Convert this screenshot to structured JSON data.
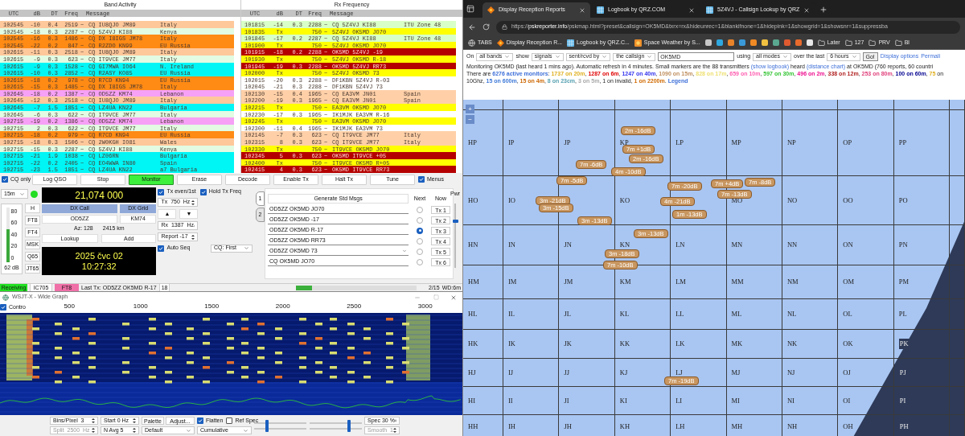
{
  "band_activity": {
    "title": "Band Activity",
    "columns": [
      "UTC",
      "dB",
      "DT",
      "Freq",
      "Message"
    ],
    "rows": [
      {
        "utc": "102545",
        "db": "-10",
        "dt": "0.4",
        "freq": "2519",
        "sep": "~",
        "message": "CQ IU8QJO JM89",
        "note": "Italy",
        "color": "#ffc89b"
      },
      {
        "utc": "102545",
        "db": "-18",
        "dt": "0.3",
        "freq": "2287",
        "sep": "~",
        "message": "CQ 5Z4VJ KI88",
        "note": "Kenya",
        "color": "#e2fbe2"
      },
      {
        "utc": "102545",
        "db": "-16",
        "dt": "0.3",
        "freq": "1486",
        "sep": "~",
        "message": "CQ DX I8IGS JM78",
        "note": "Italy",
        "color": "#ff8a14"
      },
      {
        "utc": "102545",
        "db": "-22",
        "dt": "0.2",
        "freq": "847",
        "sep": "~",
        "message": "CQ R2ZDO KN99",
        "note": "EU Russia",
        "color": "#ff8a14"
      },
      {
        "utc": "102615",
        "db": "-11",
        "dt": "0.3",
        "freq": "2518",
        "sep": "~",
        "message": "CQ IU8QJO JM89",
        "note": "Italy",
        "color": "#ffc89b"
      },
      {
        "utc": "102615",
        "db": "-9",
        "dt": "0.3",
        "freq": "623",
        "sep": "~",
        "message": "CQ IT9VCE JM77",
        "note": "Italy",
        "color": "#e2fbe2"
      },
      {
        "utc": "102615",
        "db": "-9",
        "dt": "0.3",
        "freq": "1528",
        "sep": "~",
        "message": "CQ GI7MWA IO64",
        "note": "N. Ireland",
        "color": "#00f5f5"
      },
      {
        "utc": "102615",
        "db": "-10",
        "dt": "0.3",
        "freq": "2852",
        "sep": "~",
        "message": "CQ R2ASY KO85",
        "note": "EU Russia",
        "color": "#00f5f5"
      },
      {
        "utc": "102615",
        "db": "-18",
        "dt": "0.2",
        "freq": "978",
        "sep": "~",
        "message": "CQ R7CD KN94",
        "note": "EU Russia",
        "color": "#ff8a14"
      },
      {
        "utc": "102615",
        "db": "-15",
        "dt": "0.3",
        "freq": "1485",
        "sep": "~",
        "message": "CQ DX I8IGS JM78",
        "note": "Italy",
        "color": "#ff8a14"
      },
      {
        "utc": "102645",
        "db": "-18",
        "dt": "0.2",
        "freq": "1387",
        "sep": "~",
        "message": "CQ OD5ZZ KM74",
        "note": "Lebanon",
        "color": "#f6a0f6"
      },
      {
        "utc": "102645",
        "db": "-12",
        "dt": "0.3",
        "freq": "2518",
        "sep": "~",
        "message": "CQ IU8QJO JM89",
        "note": "Italy",
        "color": "#ffc89b"
      },
      {
        "utc": "102645",
        "db": "-7",
        "dt": "1.5",
        "freq": "1851",
        "sep": "~",
        "message": "CQ LZ4UA KN22",
        "note": "Bulgaria",
        "color": "#00f5f5"
      },
      {
        "utc": "102645",
        "db": "-6",
        "dt": "0.3",
        "freq": "622",
        "sep": "~",
        "message": "CQ IT9VCE JM77",
        "note": "Italy",
        "color": "#e2fbe2"
      },
      {
        "utc": "102715",
        "db": "-19",
        "dt": "0.2",
        "freq": "1386",
        "sep": "~",
        "message": "CQ OD5ZZ KM74",
        "note": "Lebanon",
        "color": "#f6a0f6"
      },
      {
        "utc": "102715",
        "db": "2",
        "dt": "0.3",
        "freq": "622",
        "sep": "~",
        "message": "CQ IT9VCE JM77",
        "note": "Italy",
        "color": "#e2fbe2"
      },
      {
        "utc": "102715",
        "db": "-18",
        "dt": "0.2",
        "freq": "979",
        "sep": "~",
        "message": "CQ R7CD KN94",
        "note": "EU Russia",
        "color": "#ff8a14"
      },
      {
        "utc": "102715",
        "db": "-18",
        "dt": "0.3",
        "freq": "1506",
        "sep": "~",
        "message": "CQ 2W0KGH IO81",
        "note": "Wales",
        "color": "#ffc89b"
      },
      {
        "utc": "102715",
        "db": "-15",
        "dt": "0.3",
        "freq": "2287",
        "sep": "~",
        "message": "CQ 5Z4VJ KI88",
        "note": "Kenya",
        "color": "#e2fbe2"
      },
      {
        "utc": "102715",
        "db": "-21",
        "dt": "1.9",
        "freq": "1038",
        "sep": "~",
        "message": "CQ LZ06RN",
        "note": "Bulgaria",
        "color": "#00f5f5"
      },
      {
        "utc": "102715",
        "db": "-22",
        "dt": "0.2",
        "freq": "2405",
        "sep": "~",
        "message": "CQ EO4WWA IN80",
        "note": "Spain",
        "color": "#00f5f5"
      },
      {
        "utc": "102715",
        "db": "-23",
        "dt": "1.5",
        "freq": "1851",
        "sep": "~",
        "message": "CQ LZ4UA KN22",
        "note": "a7 Bulgaria",
        "color": "#00f5f5"
      }
    ]
  },
  "rx_frequency": {
    "title": "Rx Frequency",
    "columns": [
      "UTC",
      "dB",
      "DT",
      "Freq",
      "Message"
    ],
    "rows": [
      {
        "utc": "101815",
        "db": "-14",
        "dt": "0.3",
        "freq": "2288",
        "sep": "~",
        "message": "CQ 5Z4VJ KI88",
        "note": "ITU Zone 48",
        "color": "#d8ffc8"
      },
      {
        "utc": "101835",
        "db": "Tx",
        "freq": "750",
        "sep": "~",
        "message": "5Z4VJ OK5MD JO70",
        "color": "#ffff00"
      },
      {
        "utc": "101845",
        "db": "-17",
        "dt": "0.2",
        "freq": "2287",
        "sep": "~",
        "message": "CQ 5Z4VJ KI88",
        "note": "ITU Zone 48",
        "color": "#d8ffc8"
      },
      {
        "utc": "101900",
        "db": "Tx",
        "freq": "750",
        "sep": "~",
        "message": "5Z4VJ OK5MD JO70",
        "color": "#ffff00"
      },
      {
        "utc": "101915",
        "db": "-18",
        "dt": "0.2",
        "freq": "2288",
        "sep": "~",
        "message": "OK5MD 5Z4VJ -19",
        "color": "#b40000"
      },
      {
        "utc": "101930",
        "db": "Tx",
        "freq": "750",
        "sep": "~",
        "message": "5Z4VJ OK5MD R-18",
        "color": "#ffff00"
      },
      {
        "utc": "101945",
        "db": "-19",
        "dt": "0.3",
        "freq": "2288",
        "sep": "~",
        "message": "OK5MD 5Z4VJ RR73",
        "color": "#b40000"
      },
      {
        "utc": "102000",
        "db": "Tx",
        "freq": "750",
        "sep": "~",
        "message": "5Z4VJ OK5MD 73",
        "color": "#ffff00"
      },
      {
        "utc": "102015",
        "db": "-20",
        "dt": "0.3",
        "freq": "2288",
        "sep": "~",
        "message": "DF1KBN 5Z4VJ R-03",
        "color": "#ffffff"
      },
      {
        "utc": "102045",
        "db": "-21",
        "dt": "0.3",
        "freq": "2288",
        "sep": "~",
        "message": "DF1KBN 5Z4VJ 73",
        "color": "#ffffff"
      },
      {
        "utc": "102130",
        "db": "-15",
        "dt": "0.4",
        "freq": "1965",
        "sep": "~",
        "message": "CQ EA3VM JN01",
        "note": "Spain",
        "color": "#ffd0a8"
      },
      {
        "utc": "102200",
        "db": "-19",
        "dt": "0.3",
        "freq": "1965",
        "sep": "~",
        "message": "CQ EA3VM JN01",
        "note": "Spain",
        "color": "#ffd0a8"
      },
      {
        "utc": "102215",
        "db": "Tx",
        "freq": "750",
        "sep": "~",
        "message": "EA3VM OK5MD JO70",
        "color": "#ffff00"
      },
      {
        "utc": "102230",
        "db": "-17",
        "dt": "0.3",
        "freq": "1965",
        "sep": "~",
        "message": "IK1MJK EA3VM R-16",
        "color": "#ffffff"
      },
      {
        "utc": "102245",
        "db": "Tx",
        "freq": "750",
        "sep": "~",
        "message": "EA3VM OK5MD JO70",
        "color": "#ffff00"
      },
      {
        "utc": "102300",
        "db": "-11",
        "dt": "0.4",
        "freq": "1965",
        "sep": "~",
        "message": "IK1MJK EA3VM 73",
        "color": "#ffffff"
      },
      {
        "utc": "102145",
        "db": "-7",
        "dt": "0.3",
        "freq": "623",
        "sep": "~",
        "message": "CQ IT9VCE JM77",
        "note": "Italy",
        "color": "#ffd0a8"
      },
      {
        "utc": "102315",
        "db": "8",
        "dt": "0.3",
        "freq": "623",
        "sep": "~",
        "message": "CQ IT9VCE JM77",
        "note": "Italy",
        "color": "#ffd0a8"
      },
      {
        "utc": "102330",
        "db": "Tx",
        "freq": "750",
        "sep": "~",
        "message": "IT9VCE OK5MD JO70",
        "color": "#ffff00"
      },
      {
        "utc": "102345",
        "db": "5",
        "dt": "0.3",
        "freq": "623",
        "sep": "~",
        "message": "OK5MD IT9VCE +05",
        "color": "#b40000"
      },
      {
        "utc": "102400",
        "db": "Tx",
        "freq": "750",
        "sep": "~",
        "message": "IT9VCE OK5MD R+05",
        "color": "#ffff00"
      },
      {
        "utc": "102415",
        "db": "4",
        "dt": "0.3",
        "freq": "623",
        "sep": "~",
        "message": "OK5MD IT9VCE RR73",
        "color": "#b40000"
      }
    ]
  },
  "controls": {
    "cq_only": {
      "label": "CQ only",
      "checked": true
    },
    "top_buttons": [
      {
        "label": "Log QSO",
        "on": false
      },
      {
        "label": "Stop",
        "on": false
      },
      {
        "label": "Monitor",
        "on": true
      },
      {
        "label": "Erase",
        "on": false
      },
      {
        "label": "Decode",
        "on": false
      },
      {
        "label": "Enable Tx",
        "on": false
      },
      {
        "label": "Halt Tx",
        "on": false
      },
      {
        "label": "Tune",
        "on": false
      }
    ],
    "menus": {
      "label": "Menus",
      "checked": true
    },
    "band": "15m",
    "frequency": "21,074 000",
    "meter": {
      "ticks": [
        "80",
        "60",
        "40",
        "20",
        "0"
      ],
      "level": 0.6,
      "reading": "62 dB"
    },
    "modes": [
      "H",
      "FT8",
      "FT4",
      "MSK",
      "Q65",
      "JT65"
    ],
    "dx": {
      "call_label": "DX Call",
      "grid_label": "DX Grid",
      "call": "OD5ZZ",
      "grid": "KM74",
      "az": "Az: 128",
      "distance": "2415 km"
    },
    "lookup": "Lookup",
    "add": "Add",
    "clock": {
      "date": "2025 čvc 02",
      "time": "10:27:32"
    },
    "tx_even": {
      "label": "Tx even/1st",
      "checked": true
    },
    "hold_tx": {
      "label": "Hold Tx Freq",
      "checked": true
    },
    "tx_freq": "Tx  750  Hz",
    "up": "▲",
    "down": "▼",
    "rx_freq": "Rx  1387  Hz",
    "report": "Report -17",
    "auto_seq": {
      "label": "Auto Seq",
      "checked": true
    },
    "cq_mode": "CQ: First",
    "msg_tabs": [
      {
        "label": "1",
        "selected": true
      },
      {
        "label": "2",
        "selected": false
      }
    ],
    "generate": "Generate Std Msgs",
    "next_label": "Next",
    "now_label": "Now",
    "messages": [
      {
        "text": "OD5ZZ OK5MD JO70",
        "kind": "field",
        "selected": false,
        "button": "Tx 1"
      },
      {
        "text": "OD5ZZ OK5MD -17",
        "kind": "field",
        "selected": false,
        "button": "Tx 2"
      },
      {
        "text": "OD5ZZ OK5MD R-17",
        "kind": "field",
        "selected": true,
        "button": "Tx 3"
      },
      {
        "text": "OD5ZZ OK5MD RR73",
        "kind": "field",
        "selected": false,
        "button": "Tx 4"
      },
      {
        "text": "OD5ZZ OK5MD 73",
        "kind": "dropdown",
        "selected": false,
        "button": "Tx 5"
      },
      {
        "text": "CQ OK5MD JO70",
        "kind": "field",
        "selected": false,
        "button": "Tx 6"
      }
    ],
    "pwr": {
      "label": "Pwr",
      "level": 0.75
    }
  },
  "status_bar": {
    "state": "Receiving",
    "rig": "IC705",
    "mode": "FT8",
    "last_tx": "Last Tx: OD5ZZ OK5MD R-17",
    "count": "18",
    "progress": {
      "level": 0.13
    },
    "period": "2/15",
    "wd": "WD:6m"
  },
  "wide_graph": {
    "title": "WSJT-X - Wide Graph",
    "control": {
      "label": "Contro",
      "checked": true
    },
    "scale": [
      "500",
      "1000",
      "1500",
      "2000",
      "2500",
      "3000"
    ],
    "bins": "Bins/Pixel  3",
    "split": {
      "text": "Split  2500  Hz",
      "disabled": true
    },
    "start": "Start 0 Hz",
    "navg": "N Avg 5",
    "palette_label": "Palette",
    "adjust": "Adjust...",
    "palette": "Default",
    "flatten": {
      "label": "Flatten",
      "checked": true
    },
    "ref_spec": {
      "label": "Ref Spec",
      "checked": false
    },
    "spectrum_mode": "Cumulative",
    "sliders": [
      {
        "level": 0.25
      },
      {
        "level": 0.76
      },
      {
        "level": 0.25
      },
      {
        "level": 0.76
      }
    ],
    "spec": "Spec 30 %",
    "smooth": {
      "text": "Smooth  1",
      "disabled": true
    }
  },
  "browser": {
    "tabs": [
      {
        "title": "Display Reception Reports",
        "kind": "psk",
        "selected": true
      },
      {
        "title": "Logbook by QRZ.COM",
        "kind": "qrz",
        "selected": false
      },
      {
        "title": "5Z4VJ - Callsign Lookup by QRZ",
        "kind": "qrz",
        "selected": false
      }
    ],
    "address": {
      "scheme": "https://",
      "host": "pskreporter.info",
      "path": "/pskmap.html?preset&callsign=OK5MD&txrx=rx&hideunrec=1&blankifnone=1&hidepink=1&showgrid=1&showsnr=1&suppressba"
    },
    "bookmarks": [
      {
        "kind": "globe",
        "label": "TABS"
      },
      {
        "kind": "psk",
        "label": "Display Reception R..."
      },
      {
        "kind": "qrz",
        "label": "Logbook by QRZ.C..."
      },
      {
        "kind": "sun",
        "label": "Space Weather by S..."
      },
      {
        "kind": "icon",
        "color": "#c8c8c8"
      },
      {
        "kind": "icon",
        "color": "#2fa8e0"
      },
      {
        "kind": "icon",
        "color": "#e8832a"
      },
      {
        "kind": "icon",
        "color": "#3a9ad9"
      },
      {
        "kind": "icon",
        "color": "#f08a24"
      },
      {
        "kind": "icon",
        "color": "#f0c040"
      },
      {
        "kind": "icon",
        "color": "#5aa890"
      },
      {
        "kind": "icon",
        "color": "#e05a30"
      },
      {
        "kind": "icon",
        "color": "#e86a2c"
      },
      {
        "kind": "icon",
        "color": "#e8e8e8"
      },
      {
        "kind": "folder",
        "label": "Later"
      },
      {
        "kind": "folder",
        "label": "127"
      },
      {
        "kind": "folder",
        "label": "PRV"
      },
      {
        "kind": "folder",
        "label": "Bl"
      }
    ],
    "form": [
      {
        "kind": "text",
        "text": "On"
      },
      {
        "kind": "select",
        "text": "all bands"
      },
      {
        "kind": "text",
        "text": "show"
      },
      {
        "kind": "select",
        "text": "signals"
      },
      {
        "kind": "select",
        "text": "sent/rcvd by"
      },
      {
        "kind": "select",
        "text": "the callsign"
      },
      {
        "kind": "input",
        "text": "OK5MD"
      },
      {
        "kind": "text",
        "text": "using"
      },
      {
        "kind": "select",
        "text": "all modes"
      },
      {
        "kind": "text",
        "text": "over the last"
      },
      {
        "kind": "select",
        "text": "6 hours"
      },
      {
        "kind": "button",
        "text": "Go!"
      },
      {
        "kind": "link",
        "text": "Display options"
      },
      {
        "kind": "link",
        "text": "Permali"
      }
    ],
    "monitoring": [
      {
        "text": "Monitoring OK5MD (last heard 1 mins ago). Automatic refresh in 4 minutes. Small markers are the 88 transmitters "
      },
      {
        "text": "(show logbook)",
        "link": true
      },
      {
        "text": " heard "
      },
      {
        "text": "(distance chart)",
        "link": true
      },
      {
        "text": " at OK5MD (760 reports, 60 countri"
      }
    ],
    "monitors": [
      {
        "text": "There are "
      },
      {
        "text": "6276 active monitors",
        "color": "#3d6fd8"
      },
      {
        "text": ": "
      },
      {
        "text": "1737 on 20m",
        "color": "#e0b020",
        "sep": ", "
      },
      {
        "text": "1287 on 6m",
        "color": "#e00000",
        "sep": ", "
      },
      {
        "text": "1247 on 40m",
        "color": "#3333ee",
        "sep": ", "
      },
      {
        "text": "1090 on 15m",
        "color": "#c09060",
        "sep": ", "
      },
      {
        "text": "828 on 17m",
        "color": "#eee070",
        "sep": ", "
      },
      {
        "text": "659 on 10m",
        "color": "#ff5fb0",
        "sep": ", "
      },
      {
        "text": "597 on 30m",
        "color": "#33c433",
        "sep": ", "
      },
      {
        "text": "496 on 2m",
        "color": "#ee1090",
        "sep": ", "
      },
      {
        "text": "338 on 12m",
        "color": "#b02020",
        "sep": ", "
      },
      {
        "text": "253 on 80m",
        "color": "#e0407b",
        "sep": ", "
      },
      {
        "text": "100 on 60m",
        "color": "#000090",
        "sep": ", "
      },
      {
        "text": "75",
        "color": "#e0b020"
      },
      {
        "text": " on 10Ghz",
        "sep": ", "
      },
      {
        "text": "15 on 600m",
        "color": "#3d78d8",
        "sep": ", "
      },
      {
        "text": "15 on 4m",
        "color": "#cc6600",
        "sep": ", "
      },
      {
        "text": "8 on 23cm",
        "color": "#55a0b0",
        "sep": ", "
      },
      {
        "text": "3 on 5m",
        "color": "#a8a8a8",
        "sep": ", "
      },
      {
        "text": "1 on invalid",
        "sep": ", "
      },
      {
        "text": "1 on 2200m",
        "color": "#d06a00",
        "sep": ". "
      },
      {
        "text": "Legend",
        "color": "#3d6fd8"
      }
    ]
  },
  "map": {
    "zoom_in": "+",
    "zoom_out": "−",
    "grid_rows": [
      [
        "HP",
        "IP",
        "JP",
        "KP",
        "LP",
        "MP",
        "NP",
        "OP",
        "PP"
      ],
      [
        "HO",
        "IO",
        null,
        "KO",
        null,
        "MO",
        "NO",
        "OO",
        "PO"
      ],
      [
        "HN",
        "IN",
        "JN",
        "KN",
        "LN",
        "MN",
        "NN",
        "ON",
        "PN"
      ],
      [
        "HM",
        "IM",
        "JM",
        "KM",
        "LM",
        "MM",
        "NM",
        "OM",
        "PM"
      ],
      [
        "HL",
        "IL",
        "JL",
        "KL",
        "LL",
        "ML",
        "NL",
        "OL",
        "PL"
      ],
      [
        "HK",
        "IK",
        "JK",
        "KK",
        "LK",
        "MK",
        "NK",
        "OK",
        "PK"
      ],
      [
        "HJ",
        "IJ",
        "JJ",
        "KJ",
        "LJ",
        "MJ",
        "NJ",
        "OJ",
        "PJ"
      ],
      [
        "HI",
        "II",
        "JI",
        "KI",
        "LI",
        "MI",
        "NI",
        "OI",
        "PI"
      ],
      [
        "HH",
        "IH",
        "JH",
        "KH",
        "LH",
        "MH",
        "NH",
        "OH",
        "PH"
      ]
    ],
    "markers": [
      "2m -16dB",
      "7m +1dB",
      "2m -16dB",
      "7m -6dB",
      "4m -10dB",
      "7m -5dB",
      "3m -21dB",
      "3m -15dB",
      "3m -13dB",
      "7m -20dB",
      "4m -21dB",
      "7m +4dB",
      "7m -8dB",
      "7m -13dB",
      "1m -13dB",
      "3m -13dB",
      "3m -18dB",
      "7m -10dB",
      "7m -19dB"
    ]
  }
}
